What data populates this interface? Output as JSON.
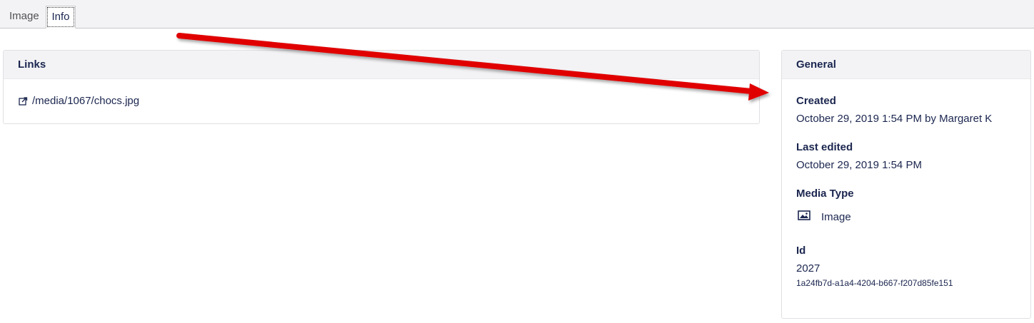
{
  "tabs": [
    {
      "label": "Image"
    },
    {
      "label": "Info"
    }
  ],
  "links_panel": {
    "title": "Links",
    "link": "/media/1067/chocs.jpg"
  },
  "general_panel": {
    "title": "General",
    "created_label": "Created",
    "created_value": "October 29, 2019 1:54 PM by Margaret K",
    "last_edited_label": "Last edited",
    "last_edited_value": "October 29, 2019 1:54 PM",
    "media_type_label": "Media Type",
    "media_type_value": "Image",
    "media_type_icon": "image-icon",
    "id_label": "Id",
    "id_value": "2027",
    "guid_value": "1a24fb7d-a1a4-4204-b667-f207d85fe151"
  },
  "colors": {
    "text": "#1b264f",
    "annotation_arrow": "#e00000"
  }
}
